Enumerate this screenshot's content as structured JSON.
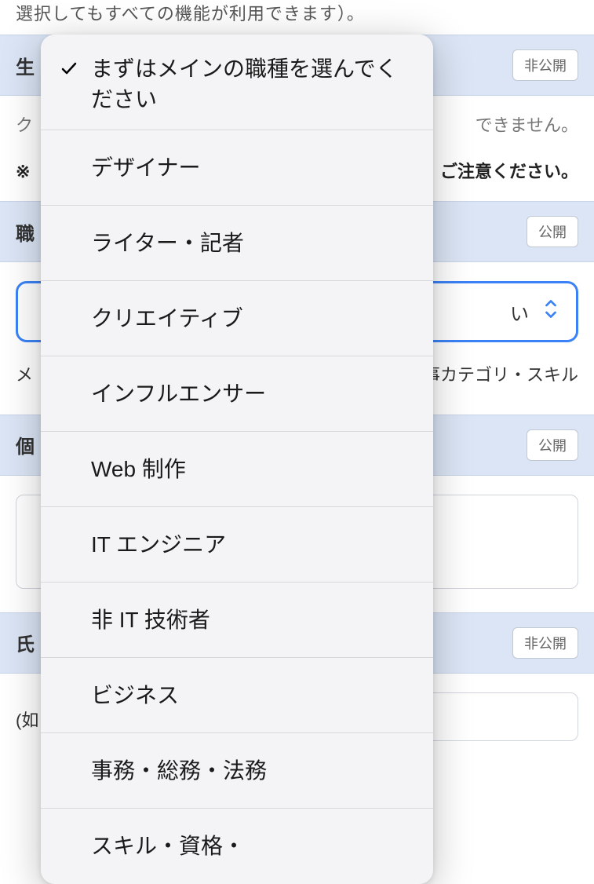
{
  "intro": "選択してもすべての機能が利用できます）。",
  "sections": {
    "birth": {
      "title": "生",
      "badge": "非公開"
    },
    "job": {
      "title": "職",
      "badge": "公開"
    },
    "personal": {
      "title": "個",
      "badge": "公開"
    },
    "name": {
      "title": "氏",
      "badge": "非公開"
    }
  },
  "body": {
    "gray_line_prefix": "ク",
    "gray_line_suffix": "できません。",
    "warn_prefix": "※",
    "warn_suffix": "ご注意ください。",
    "select_value_suffix": "い",
    "desc_prefix": "メ",
    "desc_suffix": "事カテゴリ・スキル",
    "name_label_prefix": "(如"
  },
  "dropdown": {
    "items": [
      {
        "label": "まずはメインの職種を選んでください",
        "checked": true
      },
      {
        "label": "デザイナー",
        "checked": false
      },
      {
        "label": "ライター・記者",
        "checked": false
      },
      {
        "label": "クリエイティブ",
        "checked": false
      },
      {
        "label": "インフルエンサー",
        "checked": false
      },
      {
        "label": "Web 制作",
        "checked": false
      },
      {
        "label": "IT エンジニア",
        "checked": false
      },
      {
        "label": "非 IT 技術者",
        "checked": false
      },
      {
        "label": "ビジネス",
        "checked": false
      },
      {
        "label": "事務・総務・法務",
        "checked": false
      },
      {
        "label": "スキル・資格・",
        "checked": false
      }
    ]
  }
}
